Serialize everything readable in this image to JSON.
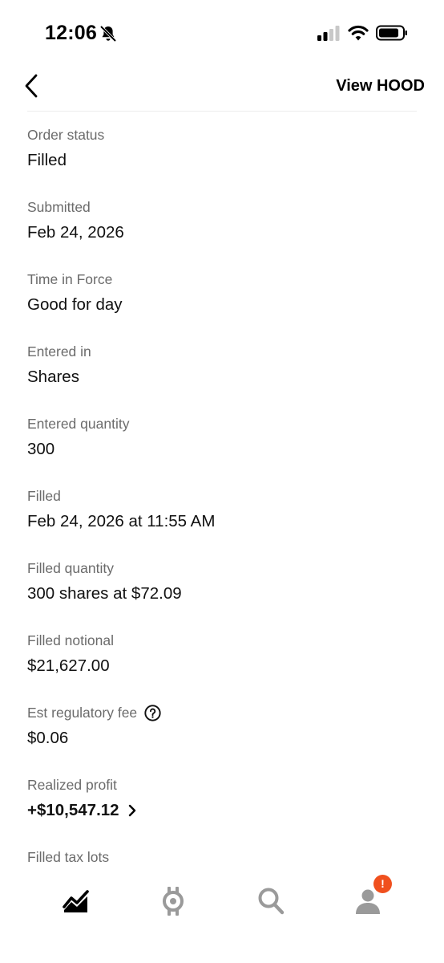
{
  "status_bar": {
    "time": "12:06",
    "icons": [
      "bell-slash-icon",
      "cellular-signal-icon",
      "wifi-icon",
      "battery-icon"
    ]
  },
  "header": {
    "back_icon": "chevron-left-icon",
    "view_link": "View HOOD"
  },
  "details": [
    {
      "label": "Order status",
      "value": "Filled"
    },
    {
      "label": "Submitted",
      "value": "Feb 24, 2026"
    },
    {
      "label": "Time in Force",
      "value": "Good for day"
    },
    {
      "label": "Entered in",
      "value": "Shares"
    },
    {
      "label": "Entered quantity",
      "value": "300"
    },
    {
      "label": "Filled",
      "value": "Feb 24, 2026 at 11:55 AM"
    },
    {
      "label": "Filled quantity",
      "value": "300 shares at $72.09"
    },
    {
      "label": "Filled notional",
      "value": "$21,627.00"
    },
    {
      "label": "Est regulatory fee",
      "value": "$0.06",
      "icon": "help-circle-icon"
    },
    {
      "label": "Realized profit",
      "value": "+$10,547.12",
      "icon": "chevron-right-icon"
    },
    {
      "label": "Filled tax lots"
    }
  ],
  "tab_bar": {
    "tabs": [
      {
        "name": "home",
        "icon": "investing-chart-icon",
        "active": true
      },
      {
        "name": "crypto",
        "icon": "crypto-coin-icon",
        "active": false
      },
      {
        "name": "search",
        "icon": "search-icon",
        "active": false
      },
      {
        "name": "account",
        "icon": "person-icon",
        "active": false
      }
    ],
    "account_badge": "!"
  },
  "colors": {
    "label_gray": "#6b6b6b",
    "value_black": "#111111",
    "tab_inactive": "#9a9a9a",
    "badge_orange": "#f0501e"
  }
}
